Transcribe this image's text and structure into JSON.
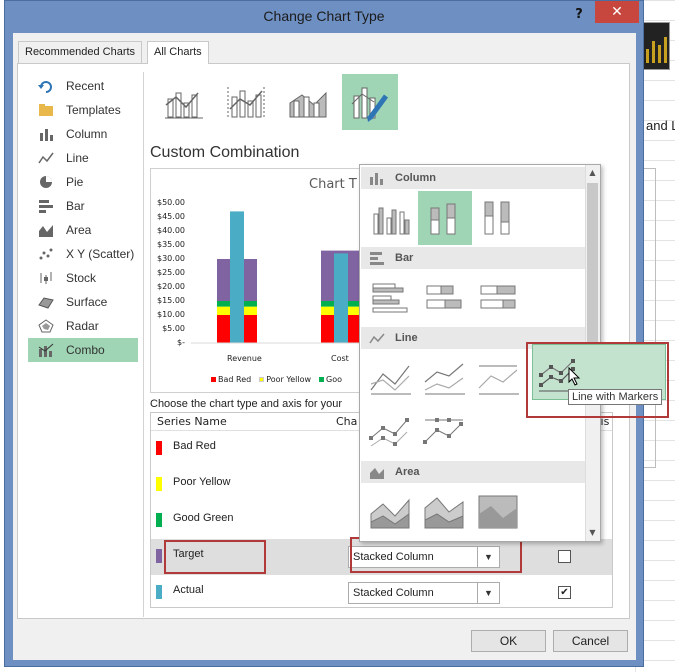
{
  "dialog": {
    "title": "Change Chart Type",
    "help": "?",
    "close": "✕",
    "tabs": [
      "Recommended Charts",
      "All Charts"
    ]
  },
  "sidebar": [
    {
      "label": "Recent",
      "icon": "recent-icon"
    },
    {
      "label": "Templates",
      "icon": "folder-icon"
    },
    {
      "label": "Column",
      "icon": "column-chart-icon"
    },
    {
      "label": "Line",
      "icon": "line-chart-icon"
    },
    {
      "label": "Pie",
      "icon": "pie-chart-icon"
    },
    {
      "label": "Bar",
      "icon": "bar-chart-icon"
    },
    {
      "label": "Area",
      "icon": "area-chart-icon"
    },
    {
      "label": "X Y (Scatter)",
      "icon": "scatter-chart-icon"
    },
    {
      "label": "Stock",
      "icon": "stock-chart-icon"
    },
    {
      "label": "Surface",
      "icon": "surface-chart-icon"
    },
    {
      "label": "Radar",
      "icon": "radar-chart-icon"
    },
    {
      "label": "Combo",
      "icon": "combo-chart-icon",
      "selected": true
    }
  ],
  "main": {
    "section_title": "Custom Combination",
    "choose_text": "Choose the chart type and axis for your",
    "columns": {
      "series_name": "Series Name",
      "chart_type_partial": "Cha",
      "axis_partial": "xis"
    }
  },
  "preview": {
    "title_partial": "Chart T",
    "legend": [
      {
        "label": "Bad Red",
        "color": "#ff0000"
      },
      {
        "label": "Poor Yellow",
        "color": "#ffff00"
      },
      {
        "label": "Goo",
        "color": "#00b050"
      }
    ]
  },
  "chart_data": {
    "type": "bar",
    "title": "Chart T",
    "categories": [
      "Revenue",
      "Cost"
    ],
    "yticks": [
      "$50.00",
      "$45.00",
      "$40.00",
      "$35.00",
      "$30.00",
      "$25.00",
      "$20.00",
      "$15.00",
      "$10.00",
      "$5.00",
      "$-"
    ],
    "ylim": [
      0,
      50
    ],
    "series": [
      {
        "name": "Bad Red",
        "values": [
          10,
          10
        ],
        "color": "#ff0000"
      },
      {
        "name": "Poor Yellow",
        "values": [
          3,
          3
        ],
        "color": "#ffff00"
      },
      {
        "name": "Good Green",
        "values": [
          2,
          2
        ],
        "color": "#00b050"
      },
      {
        "name": "Target",
        "values": [
          15,
          18
        ],
        "color": "#8064a2"
      },
      {
        "name": "Actual",
        "values": [
          47,
          32
        ],
        "color": "#4bacc6"
      }
    ]
  },
  "series_rows": [
    {
      "name": "Bad Red",
      "color": "#ff0000"
    },
    {
      "name": "Poor Yellow",
      "color": "#ffff00"
    },
    {
      "name": "Good Green",
      "color": "#00b050"
    },
    {
      "name": "Target",
      "color": "#8064a2",
      "chart_type": "Stacked Column",
      "secondary_axis": false,
      "selected": true
    },
    {
      "name": "Actual",
      "color": "#4bacc6",
      "chart_type": "Stacked Column",
      "secondary_axis": true
    }
  ],
  "popup": {
    "sections": [
      "Column",
      "Bar",
      "Line",
      "Area"
    ],
    "tooltip": "Line with Markers"
  },
  "background": {
    "partial_text": "and L"
  },
  "buttons": {
    "ok": "OK",
    "cancel": "Cancel"
  }
}
